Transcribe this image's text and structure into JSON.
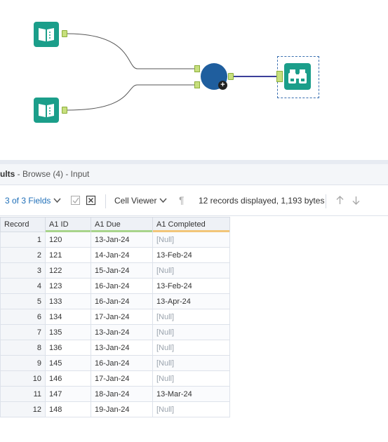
{
  "canvas": {
    "input_tool_1_icon": "book-icon",
    "input_tool_2_icon": "book-icon",
    "join_tool_icon": "join-circle-icon",
    "browse_tool_icon": "binoculars-icon",
    "colors": {
      "tool_teal": "#1b9e8a",
      "join_blue": "#1f5e9e",
      "anchor_green": "#c7df7d",
      "connector_purple": "#3c3f9a"
    }
  },
  "results": {
    "title_bold": "ults",
    "title_rest": " - Browse (4) - Input"
  },
  "toolbar": {
    "fields_label": "3 of 3 Fields",
    "cell_viewer_label": "Cell Viewer",
    "records_status": "12 records displayed, 1,193 bytes",
    "icons": [
      "chevron-down-icon",
      "checkbox-icon",
      "deselect-icon",
      "chevron-down-icon",
      "pilcrow-icon",
      "arrow-up-icon",
      "arrow-down-icon"
    ]
  },
  "grid": {
    "headers": [
      "Record",
      "A1 ID",
      "A1 Due",
      "A1 Completed"
    ],
    "header_underline_colors": [
      "",
      "#a8d48b",
      "#a8d48b",
      "#f2c679"
    ],
    "rows": [
      [
        "1",
        "120",
        "13-Jan-24",
        "[Null]"
      ],
      [
        "2",
        "121",
        "14-Jan-24",
        "13-Feb-24"
      ],
      [
        "3",
        "122",
        "15-Jan-24",
        "[Null]"
      ],
      [
        "4",
        "123",
        "16-Jan-24",
        "13-Feb-24"
      ],
      [
        "5",
        "133",
        "16-Jan-24",
        "13-Apr-24"
      ],
      [
        "6",
        "134",
        "17-Jan-24",
        "[Null]"
      ],
      [
        "7",
        "135",
        "13-Jan-24",
        "[Null]"
      ],
      [
        "8",
        "136",
        "13-Jan-24",
        "[Null]"
      ],
      [
        "9",
        "145",
        "16-Jan-24",
        "[Null]"
      ],
      [
        "10",
        "146",
        "17-Jan-24",
        "[Null]"
      ],
      [
        "11",
        "147",
        "18-Jan-24",
        "13-Mar-24"
      ],
      [
        "12",
        "148",
        "19-Jan-24",
        "[Null]"
      ]
    ]
  }
}
